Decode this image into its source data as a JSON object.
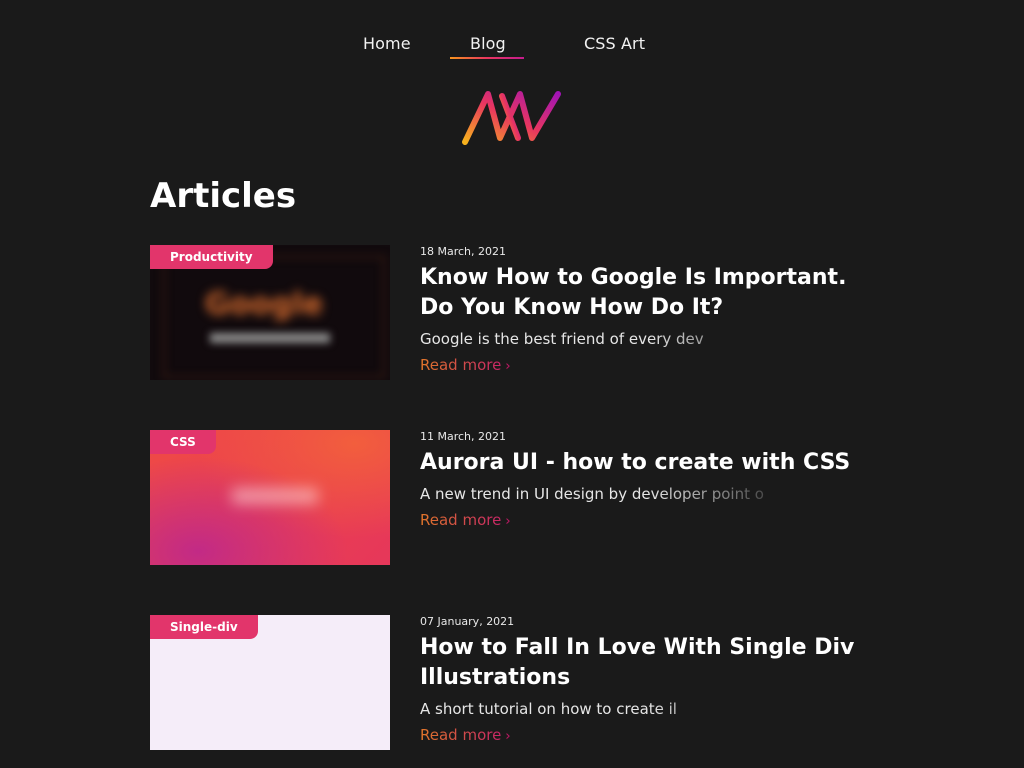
{
  "nav": {
    "items": [
      {
        "label": "Home"
      },
      {
        "label": "Blog"
      },
      {
        "label": "CSS Art"
      }
    ],
    "active": "Blog"
  },
  "logo": {
    "icon": "aw-logo-icon",
    "colors": [
      "#f7b21d",
      "#e9365f",
      "#a114b5"
    ]
  },
  "page": {
    "title": "Articles"
  },
  "articles": [
    {
      "tag": "Productivity",
      "date": "18 March, 2021",
      "title": "Know How to Google Is Important. Do You Know How Do It?",
      "excerpt": "Google is the best friend of every dev",
      "read_more": "Read more"
    },
    {
      "tag": "CSS",
      "date": "11 March, 2021",
      "title": "Aurora UI - how to create with CSS",
      "excerpt": "A new trend in UI design by developer point o",
      "read_more": "Read more"
    },
    {
      "tag": "Single-div",
      "date": "07 January, 2021",
      "title": "How to Fall In Love With Single Div Illustrations",
      "excerpt": "A short tutorial on how to create il",
      "read_more": "Read more"
    }
  ],
  "colors": {
    "background": "#1a1a1a",
    "tag": "#e2356b",
    "accent_start": "#f7941d",
    "accent_end": "#c41c8e"
  }
}
